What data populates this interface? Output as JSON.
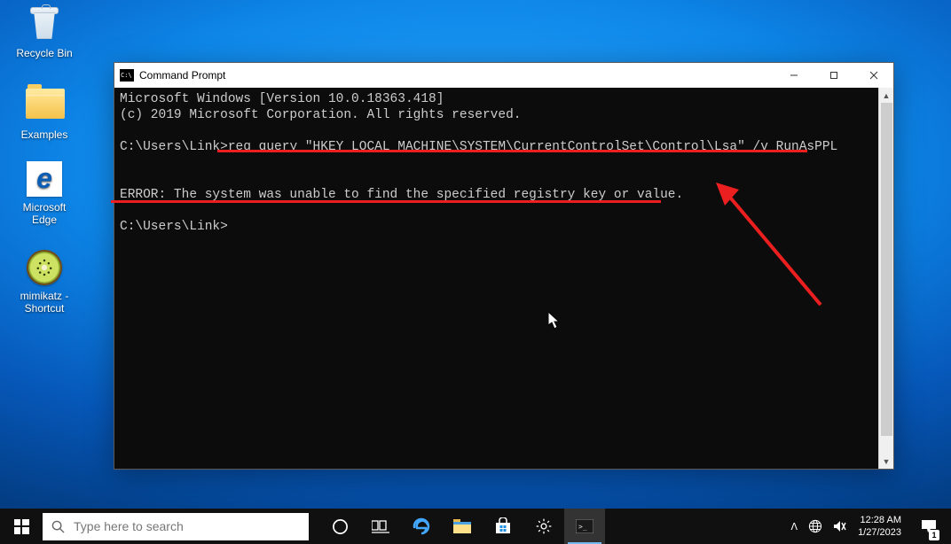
{
  "desktop_icons": {
    "recycle_bin": "Recycle Bin",
    "examples": "Examples",
    "edge": "Microsoft Edge",
    "mimikatz": "mimikatz - Shortcut"
  },
  "cmd": {
    "title": "Command Prompt",
    "banner_line1": "Microsoft Windows [Version 10.0.18363.418]",
    "banner_line2": "(c) 2019 Microsoft Corporation. All rights reserved.",
    "prompt1_path": "C:\\Users\\Link>",
    "prompt1_cmd": "reg query \"HKEY_LOCAL_MACHINE\\SYSTEM\\CurrentControlSet\\Control\\Lsa\" /v RunAsPPL",
    "error_line": "ERROR: The system was unable to find the specified registry key or value.",
    "prompt2_path": "C:\\Users\\Link>"
  },
  "taskbar": {
    "search_placeholder": "Type here to search",
    "clock_time": "12:28 AM",
    "clock_date": "1/27/2023",
    "notif_count": "1"
  },
  "colors": {
    "annotation_red": "#eb1f1f",
    "term_bg": "#0c0c0c",
    "term_fg": "#cccccc"
  }
}
